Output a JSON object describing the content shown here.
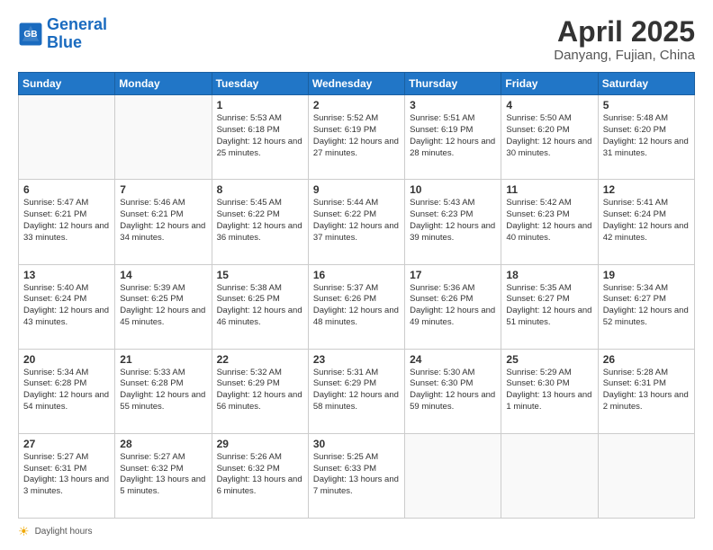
{
  "logo": {
    "line1": "General",
    "line2": "Blue"
  },
  "title": "April 2025",
  "subtitle": "Danyang, Fujian, China",
  "days_of_week": [
    "Sunday",
    "Monday",
    "Tuesday",
    "Wednesday",
    "Thursday",
    "Friday",
    "Saturday"
  ],
  "footer": "Daylight hours",
  "weeks": [
    [
      {
        "day": "",
        "info": ""
      },
      {
        "day": "",
        "info": ""
      },
      {
        "day": "1",
        "info": "Sunrise: 5:53 AM\nSunset: 6:18 PM\nDaylight: 12 hours and 25 minutes."
      },
      {
        "day": "2",
        "info": "Sunrise: 5:52 AM\nSunset: 6:19 PM\nDaylight: 12 hours and 27 minutes."
      },
      {
        "day": "3",
        "info": "Sunrise: 5:51 AM\nSunset: 6:19 PM\nDaylight: 12 hours and 28 minutes."
      },
      {
        "day": "4",
        "info": "Sunrise: 5:50 AM\nSunset: 6:20 PM\nDaylight: 12 hours and 30 minutes."
      },
      {
        "day": "5",
        "info": "Sunrise: 5:48 AM\nSunset: 6:20 PM\nDaylight: 12 hours and 31 minutes."
      }
    ],
    [
      {
        "day": "6",
        "info": "Sunrise: 5:47 AM\nSunset: 6:21 PM\nDaylight: 12 hours and 33 minutes."
      },
      {
        "day": "7",
        "info": "Sunrise: 5:46 AM\nSunset: 6:21 PM\nDaylight: 12 hours and 34 minutes."
      },
      {
        "day": "8",
        "info": "Sunrise: 5:45 AM\nSunset: 6:22 PM\nDaylight: 12 hours and 36 minutes."
      },
      {
        "day": "9",
        "info": "Sunrise: 5:44 AM\nSunset: 6:22 PM\nDaylight: 12 hours and 37 minutes."
      },
      {
        "day": "10",
        "info": "Sunrise: 5:43 AM\nSunset: 6:23 PM\nDaylight: 12 hours and 39 minutes."
      },
      {
        "day": "11",
        "info": "Sunrise: 5:42 AM\nSunset: 6:23 PM\nDaylight: 12 hours and 40 minutes."
      },
      {
        "day": "12",
        "info": "Sunrise: 5:41 AM\nSunset: 6:24 PM\nDaylight: 12 hours and 42 minutes."
      }
    ],
    [
      {
        "day": "13",
        "info": "Sunrise: 5:40 AM\nSunset: 6:24 PM\nDaylight: 12 hours and 43 minutes."
      },
      {
        "day": "14",
        "info": "Sunrise: 5:39 AM\nSunset: 6:25 PM\nDaylight: 12 hours and 45 minutes."
      },
      {
        "day": "15",
        "info": "Sunrise: 5:38 AM\nSunset: 6:25 PM\nDaylight: 12 hours and 46 minutes."
      },
      {
        "day": "16",
        "info": "Sunrise: 5:37 AM\nSunset: 6:26 PM\nDaylight: 12 hours and 48 minutes."
      },
      {
        "day": "17",
        "info": "Sunrise: 5:36 AM\nSunset: 6:26 PM\nDaylight: 12 hours and 49 minutes."
      },
      {
        "day": "18",
        "info": "Sunrise: 5:35 AM\nSunset: 6:27 PM\nDaylight: 12 hours and 51 minutes."
      },
      {
        "day": "19",
        "info": "Sunrise: 5:34 AM\nSunset: 6:27 PM\nDaylight: 12 hours and 52 minutes."
      }
    ],
    [
      {
        "day": "20",
        "info": "Sunrise: 5:34 AM\nSunset: 6:28 PM\nDaylight: 12 hours and 54 minutes."
      },
      {
        "day": "21",
        "info": "Sunrise: 5:33 AM\nSunset: 6:28 PM\nDaylight: 12 hours and 55 minutes."
      },
      {
        "day": "22",
        "info": "Sunrise: 5:32 AM\nSunset: 6:29 PM\nDaylight: 12 hours and 56 minutes."
      },
      {
        "day": "23",
        "info": "Sunrise: 5:31 AM\nSunset: 6:29 PM\nDaylight: 12 hours and 58 minutes."
      },
      {
        "day": "24",
        "info": "Sunrise: 5:30 AM\nSunset: 6:30 PM\nDaylight: 12 hours and 59 minutes."
      },
      {
        "day": "25",
        "info": "Sunrise: 5:29 AM\nSunset: 6:30 PM\nDaylight: 13 hours and 1 minute."
      },
      {
        "day": "26",
        "info": "Sunrise: 5:28 AM\nSunset: 6:31 PM\nDaylight: 13 hours and 2 minutes."
      }
    ],
    [
      {
        "day": "27",
        "info": "Sunrise: 5:27 AM\nSunset: 6:31 PM\nDaylight: 13 hours and 3 minutes."
      },
      {
        "day": "28",
        "info": "Sunrise: 5:27 AM\nSunset: 6:32 PM\nDaylight: 13 hours and 5 minutes."
      },
      {
        "day": "29",
        "info": "Sunrise: 5:26 AM\nSunset: 6:32 PM\nDaylight: 13 hours and 6 minutes."
      },
      {
        "day": "30",
        "info": "Sunrise: 5:25 AM\nSunset: 6:33 PM\nDaylight: 13 hours and 7 minutes."
      },
      {
        "day": "",
        "info": ""
      },
      {
        "day": "",
        "info": ""
      },
      {
        "day": "",
        "info": ""
      }
    ]
  ]
}
